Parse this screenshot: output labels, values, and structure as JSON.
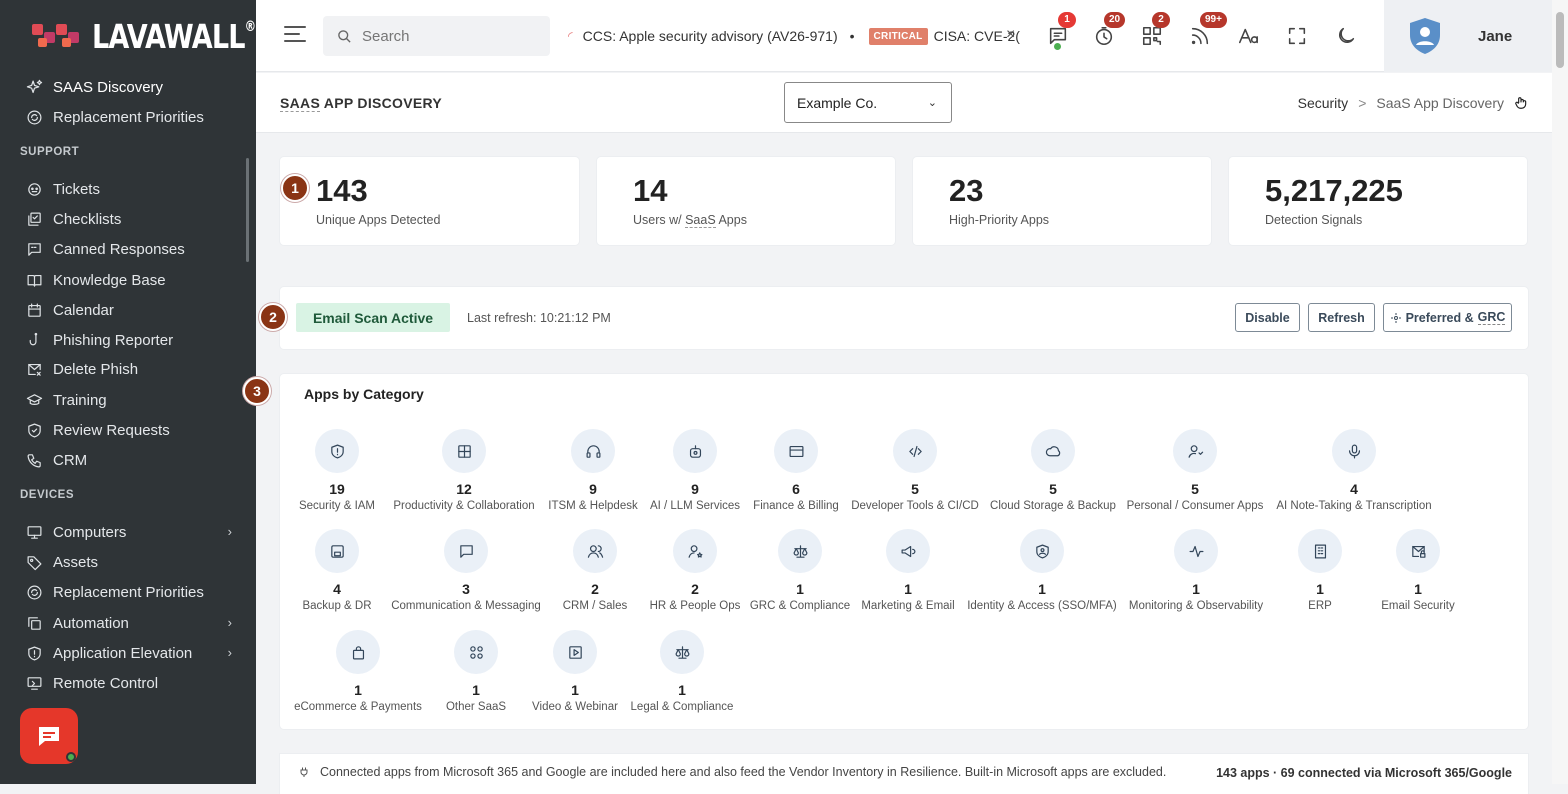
{
  "brand": {
    "name": "LAVAWALL",
    "reg": "®"
  },
  "sidebar": {
    "top_items": [
      {
        "label": "SAAS Discovery",
        "icon": "sparkle-icon",
        "active": true
      },
      {
        "label": "Replacement Priorities",
        "icon": "refresh-circle-icon"
      }
    ],
    "support_header": "SUPPORT",
    "support_items": [
      {
        "label": "Tickets",
        "icon": "ticket-icon"
      },
      {
        "label": "Checklists",
        "icon": "checklist-icon"
      },
      {
        "label": "Canned Responses",
        "icon": "message-square-icon"
      },
      {
        "label": "Knowledge Base",
        "icon": "book-icon"
      },
      {
        "label": "Calendar",
        "icon": "calendar-icon"
      },
      {
        "label": "Phishing Reporter",
        "icon": "hook-icon"
      },
      {
        "label": "Delete Phish",
        "icon": "mail-x-icon"
      },
      {
        "label": "Training",
        "icon": "graduation-cap-icon"
      },
      {
        "label": "Review Requests",
        "icon": "shield-check-icon"
      },
      {
        "label": "CRM",
        "icon": "phone-icon"
      }
    ],
    "devices_header": "DEVICES",
    "devices_items": [
      {
        "label": "Computers",
        "icon": "monitor-icon",
        "chevron": true
      },
      {
        "label": "Assets",
        "icon": "tag-icon"
      },
      {
        "label": "Replacement Priorities",
        "icon": "refresh-circle-icon"
      },
      {
        "label": "Automation",
        "icon": "copy-icon",
        "chevron": true
      },
      {
        "label": "Application Elevation",
        "icon": "shield-icon",
        "chevron": true
      },
      {
        "label": "Remote Control",
        "icon": "screen-icon"
      }
    ]
  },
  "topbar": {
    "search_placeholder": "Search",
    "ticker_text_1": "CCS: Apple security advisory (AV26-971)",
    "ticker_bullet": "•",
    "ticker_badge": "CRITICAL",
    "ticker_text_2": "CISA: CVE-2(",
    "ticker_close": "×",
    "badges": {
      "messages": "1",
      "timer": "20",
      "qr": "2",
      "feeds": "99+"
    },
    "user_name": "Jane"
  },
  "page": {
    "title_abbr": "SAAS",
    "title_rest": " APP DISCOVERY",
    "company": "Example Co.",
    "breadcrumb_parent": "Security",
    "breadcrumb_sep": ">",
    "breadcrumb_current": "SaaS App Discovery"
  },
  "stats": [
    {
      "value": "143",
      "label": "Unique Apps Detected"
    },
    {
      "value": "14",
      "label_pre": "Users w/ ",
      "label_abbr": "SaaS",
      "label_post": " Apps"
    },
    {
      "value": "23",
      "label": "High-Priority Apps"
    },
    {
      "value": "5,217,225",
      "label": "Detection Signals"
    }
  ],
  "steps": [
    "1",
    "2",
    "3"
  ],
  "scan": {
    "status": "Email Scan Active",
    "last_refresh": "Last refresh: 10:21:12 PM",
    "disable": "Disable",
    "refresh": "Refresh",
    "preferred": "Preferred &",
    "preferred_abbr": "GRC"
  },
  "categories": {
    "title": "Apps by Category",
    "items": [
      {
        "count": "19",
        "name": "Security & IAM",
        "icon": "shield-icon"
      },
      {
        "count": "12",
        "name": "Productivity & Collaboration",
        "icon": "grid-icon"
      },
      {
        "count": "9",
        "name": "ITSM & Helpdesk",
        "icon": "headset-icon"
      },
      {
        "count": "9",
        "name": "AI / LLM Services",
        "icon": "robot-icon"
      },
      {
        "count": "6",
        "name": "Finance & Billing",
        "icon": "wallet-icon"
      },
      {
        "count": "5",
        "name": "Developer Tools & CI/CD",
        "icon": "code-icon"
      },
      {
        "count": "5",
        "name": "Cloud Storage & Backup",
        "icon": "cloud-icon"
      },
      {
        "count": "5",
        "name": "Personal / Consumer Apps",
        "icon": "user-heart-icon"
      },
      {
        "count": "4",
        "name": "AI Note-Taking & Transcription",
        "icon": "microphone-icon"
      },
      {
        "count": "4",
        "name": "Backup & DR",
        "icon": "save-icon"
      },
      {
        "count": "3",
        "name": "Communication & Messaging",
        "icon": "chat-icon"
      },
      {
        "count": "2",
        "name": "CRM / Sales",
        "icon": "users-icon"
      },
      {
        "count": "2",
        "name": "HR & People Ops",
        "icon": "user-star-icon"
      },
      {
        "count": "1",
        "name": "GRC & Compliance",
        "icon": "scale-icon"
      },
      {
        "count": "1",
        "name": "Marketing & Email",
        "icon": "megaphone-icon"
      },
      {
        "count": "1",
        "name": "Identity & Access (SSO/MFA)",
        "icon": "id-shield-icon"
      },
      {
        "count": "1",
        "name": "Monitoring & Observability",
        "icon": "pulse-icon"
      },
      {
        "count": "1",
        "name": "ERP",
        "icon": "building-icon"
      },
      {
        "count": "1",
        "name": "Email Security",
        "icon": "mail-lock-icon"
      },
      {
        "count": "1",
        "name": "eCommerce & Payments",
        "icon": "bag-icon"
      },
      {
        "count": "1",
        "name": "Other SaaS",
        "icon": "apps-icon"
      },
      {
        "count": "1",
        "name": "Video & Webinar",
        "icon": "play-icon"
      },
      {
        "count": "1",
        "name": "Legal & Compliance",
        "icon": "scale-icon"
      }
    ]
  },
  "footer": {
    "note": "Connected apps from Microsoft 365 and Google are included here and also feed the Vendor Inventory in Resilience. Built-in Microsoft apps are excluded.",
    "summary": "143 apps · 69 connected via Microsoft 365/Google"
  },
  "colors": {
    "sidebar": "#2f3437",
    "accent": "#e5372a",
    "step": "#8a3414",
    "scan_pill": "#d9f3e4"
  }
}
